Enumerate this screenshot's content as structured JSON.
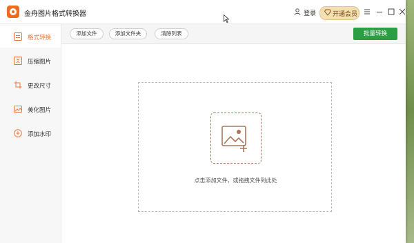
{
  "window": {
    "title": "金舟图片格式转换器",
    "login_label": "登录",
    "vip_label": "开通会员",
    "icons": [
      "user-icon",
      "diamond-icon",
      "menu-icon",
      "minimize-icon",
      "maximize-icon",
      "close-icon"
    ]
  },
  "sidebar": {
    "items": [
      {
        "label": "格式转换",
        "icon": "convert-icon",
        "active": true
      },
      {
        "label": "压缩图片",
        "icon": "compress-icon",
        "active": false
      },
      {
        "label": "更改尺寸",
        "icon": "crop-icon",
        "active": false
      },
      {
        "label": "美化图片",
        "icon": "beautify-icon",
        "active": false
      },
      {
        "label": "添加水印",
        "icon": "watermark-icon",
        "active": false
      }
    ]
  },
  "toolbar": {
    "add_file": "添加文件",
    "add_folder": "添加文件夹",
    "clear_list": "清除列表",
    "batch_convert": "批量转换"
  },
  "drop_zone": {
    "hint": "点击添加文件，或拖拽文件到此处",
    "icon": "add-image-icon"
  },
  "colors": {
    "accent_orange": "#e8783b",
    "primary_green": "#2a9d45",
    "vip_gold": "#f3dfb6",
    "icon_brown": "#a9765a"
  }
}
